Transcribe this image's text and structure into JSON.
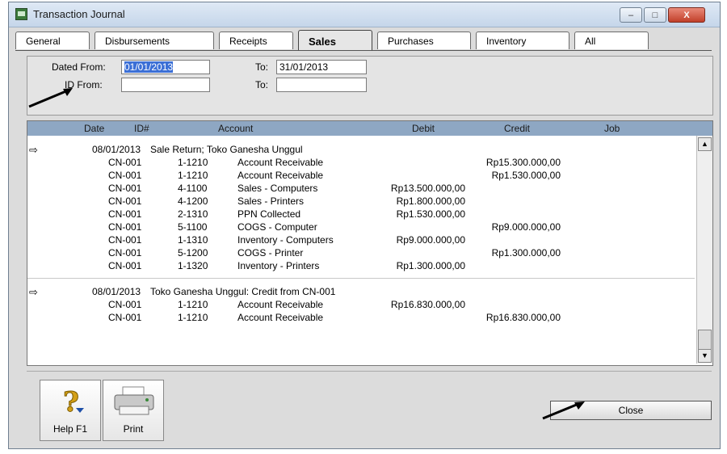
{
  "window": {
    "title": "Transaction Journal",
    "min": "–",
    "max": "□",
    "close": "X"
  },
  "tabs": [
    "General",
    "Disbursements",
    "Receipts",
    "Sales",
    "Purchases",
    "Inventory",
    "All"
  ],
  "filters": {
    "dated_from_label": "Dated From:",
    "dated_from_value": "01/01/2013",
    "to_label": "To:",
    "to_value": "31/01/2013",
    "id_from_label": "ID From:",
    "id_from_value": "",
    "id_to_label": "To:",
    "id_to_value": ""
  },
  "columns": {
    "date": "Date",
    "id": "ID#",
    "account": "Account",
    "debit": "Debit",
    "credit": "Credit",
    "job": "Job"
  },
  "groups": [
    {
      "marker": "⇨",
      "date": "08/01/2013",
      "memo": "Sale Return; Toko Ganesha Unggul",
      "lines": [
        {
          "id": "CN-001",
          "acct_no": "1-1210",
          "acct_name": "Account Receivable",
          "debit": "",
          "credit": "Rp15.300.000,00"
        },
        {
          "id": "CN-001",
          "acct_no": "1-1210",
          "acct_name": "Account Receivable",
          "debit": "",
          "credit": "Rp1.530.000,00"
        },
        {
          "id": "CN-001",
          "acct_no": "4-1100",
          "acct_name": "Sales - Computers",
          "debit": "Rp13.500.000,00",
          "credit": ""
        },
        {
          "id": "CN-001",
          "acct_no": "4-1200",
          "acct_name": "Sales - Printers",
          "debit": "Rp1.800.000,00",
          "credit": ""
        },
        {
          "id": "CN-001",
          "acct_no": "2-1310",
          "acct_name": "PPN Collected",
          "debit": "Rp1.530.000,00",
          "credit": ""
        },
        {
          "id": "CN-001",
          "acct_no": "5-1100",
          "acct_name": "COGS - Computer",
          "debit": "",
          "credit": "Rp9.000.000,00"
        },
        {
          "id": "CN-001",
          "acct_no": "1-1310",
          "acct_name": "Inventory - Computers",
          "debit": "Rp9.000.000,00",
          "credit": ""
        },
        {
          "id": "CN-001",
          "acct_no": "5-1200",
          "acct_name": "COGS - Printer",
          "debit": "",
          "credit": "Rp1.300.000,00"
        },
        {
          "id": "CN-001",
          "acct_no": "1-1320",
          "acct_name": "Inventory - Printers",
          "debit": "Rp1.300.000,00",
          "credit": ""
        }
      ]
    },
    {
      "marker": "⇨",
      "date": "08/01/2013",
      "memo": "Toko Ganesha Unggul:  Credit from CN-001",
      "lines": [
        {
          "id": "CN-001",
          "acct_no": "1-1210",
          "acct_name": "Account Receivable",
          "debit": "Rp16.830.000,00",
          "credit": ""
        },
        {
          "id": "CN-001",
          "acct_no": "1-1210",
          "acct_name": "Account Receivable",
          "debit": "",
          "credit": "Rp16.830.000,00"
        }
      ]
    }
  ],
  "buttons": {
    "help": "Help F1",
    "print": "Print",
    "close": "Close"
  },
  "icons": {
    "help": "help-question-icon",
    "print": "printer-icon",
    "app": "journal-app-icon"
  }
}
